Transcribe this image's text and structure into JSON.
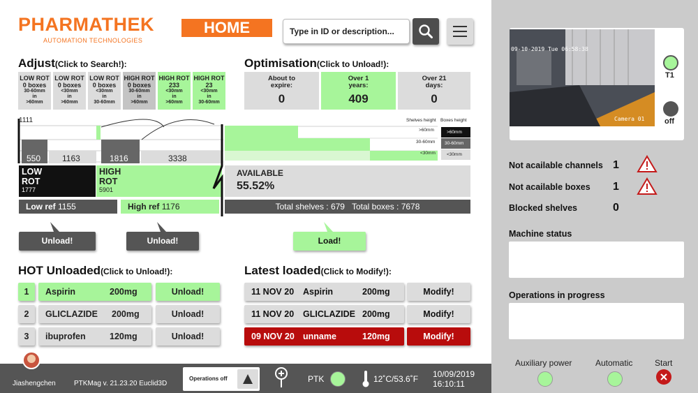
{
  "header": {
    "brand": "PHARMATHEK",
    "brand_sub": "AUTOMATION TECHNOLOGIES",
    "page": "HOME",
    "search_placeholder": "Type in ID or description..."
  },
  "adjust": {
    "title": "Adjust",
    "hint": "(Click to Search!):",
    "tiles": [
      {
        "l1": "LOW ROT",
        "l2": "0 boxes",
        "l3": "30-60mm",
        "l4": "in",
        "l5": ">60mm",
        "color": "#dcdcdc"
      },
      {
        "l1": "LOW ROT",
        "l2": "0 boxes",
        "l3": "<30mm",
        "l4": "in",
        "l5": ">60mm",
        "color": "#dcdcdc"
      },
      {
        "l1": "LOW ROT",
        "l2": "0 boxes",
        "l3": "<30mm",
        "l4": "in",
        "l5": "30-60mm",
        "color": "#dcdcdc"
      },
      {
        "l1": "HIGH ROT",
        "l2": "0 boxes",
        "l3": "30-60mm",
        "l4": "in",
        "l5": ">60mm",
        "color": "#c4c4c4"
      },
      {
        "l1": "HIGH ROT",
        "l2": "233",
        "l3": "<30mm",
        "l4": "in",
        "l5": ">60mm",
        "color": "#a7f59a"
      },
      {
        "l1": "HIGH ROT",
        "l2": "23",
        "l3": "<30mm",
        "l4": "in",
        "l5": "30-60mm",
        "color": "#a7f59a"
      }
    ],
    "scale_top": "1111",
    "bar_values": [
      "550",
      "1163",
      "1816",
      "3338"
    ],
    "low_rot": {
      "label": "LOW ROT",
      "value": "1777"
    },
    "high_rot": {
      "label": "HIGH ROT",
      "value": "5901"
    },
    "low_ref": {
      "label": "Low ref",
      "value": "1155"
    },
    "high_ref": {
      "label": "High ref",
      "value": "1176"
    },
    "unload_label": "Unload!"
  },
  "optimisation": {
    "title": "Optimisation",
    "hint": "(Click to Unload!):",
    "tiles": [
      {
        "l1": "About to",
        "l2": "expire:",
        "value": "0",
        "color": "#dcdcdc"
      },
      {
        "l1": "Over 1",
        "l2": "years:",
        "value": "409",
        "color": "#a7f59a"
      },
      {
        "l1": "Over 21",
        "l2": "days:",
        "value": "0",
        "color": "#dcdcdc"
      }
    ],
    "shelves_height": "Shelves height",
    "boxes_height": "Boxes height",
    "heights": [
      ">60mm",
      "30-60mm",
      "<30mm"
    ],
    "available_label": "AVAILABLE",
    "available_value": "55.52%",
    "total_shelves": "Total shelves : 679",
    "total_boxes": "Total boxes : 7678",
    "load_label": "Load!"
  },
  "hot_unloaded": {
    "title": "HOT Unloaded",
    "hint": "(Click to Unload!):",
    "action": "Unload!",
    "rows": [
      {
        "num": "1",
        "name": "Aspirin",
        "dose": "200mg"
      },
      {
        "num": "2",
        "name": "GLICLAZIDE",
        "dose": "200mg"
      },
      {
        "num": "3",
        "name": "ibuprofen",
        "dose": "120mg"
      }
    ]
  },
  "latest_loaded": {
    "title": "Latest loaded",
    "hint": "(Click to Modify!):",
    "action": "Modify!",
    "rows": [
      {
        "date": "11 NOV 20",
        "name": "Aspirin",
        "dose": "200mg"
      },
      {
        "date": "11 NOV 20",
        "name": "GLICLAZIDE",
        "dose": "200mg"
      },
      {
        "date": "09 NOV 20",
        "name": "unname",
        "dose": "120mg"
      }
    ]
  },
  "footer": {
    "user": "Jiashengchen",
    "version": "PTKMag v. 21.23.20 Euclid3D",
    "ops_label": "Operations off",
    "ptk_label": "PTK",
    "temperature": "12˚C/53.6˚F",
    "date": "10/09/2019",
    "time": "16:10:11"
  },
  "camera": {
    "timestamp": "09-10-2019 Tue 06:58:38",
    "name": "Camera 01",
    "t1": "T1",
    "off": "off"
  },
  "status": {
    "not_available_channels": {
      "label": "Not acailable channels",
      "value": "1"
    },
    "not_available_boxes": {
      "label": "Not acailable boxes",
      "value": "1"
    },
    "blocked_shelves": {
      "label": "Blocked shelves",
      "value": "0"
    },
    "machine_status": "Machine status",
    "operations_in_progress": "Operations in progress",
    "aux_power": "Auxiliary power",
    "automatic": "Automatic",
    "start": "Start"
  },
  "colors": {
    "orange": "#f47421",
    "green": "#a7f59a",
    "red": "#b80c0c",
    "dark": "#555555"
  }
}
